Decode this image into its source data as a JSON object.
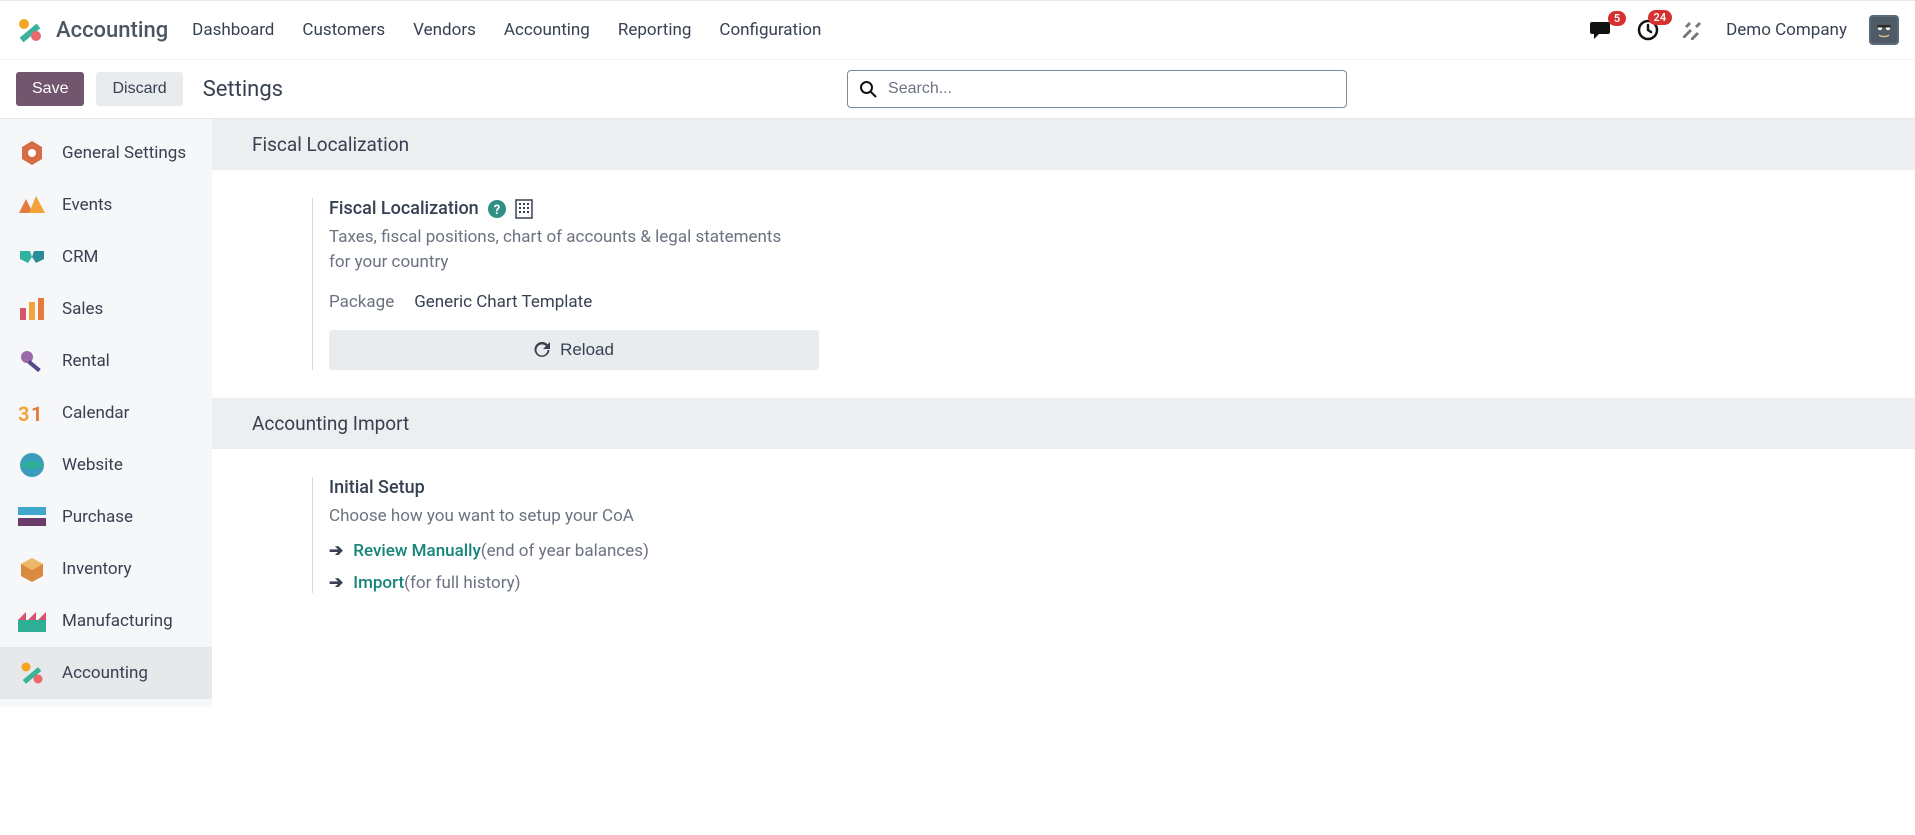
{
  "header": {
    "app_title": "Accounting",
    "nav": [
      "Dashboard",
      "Customers",
      "Vendors",
      "Accounting",
      "Reporting",
      "Configuration"
    ],
    "messages_badge": "5",
    "activities_badge": "24",
    "company": "Demo Company"
  },
  "controls": {
    "save": "Save",
    "discard": "Discard",
    "page_title": "Settings",
    "search_placeholder": "Search..."
  },
  "sidebar": {
    "items": [
      {
        "label": "General Settings"
      },
      {
        "label": "Events"
      },
      {
        "label": "CRM"
      },
      {
        "label": "Sales"
      },
      {
        "label": "Rental"
      },
      {
        "label": "Calendar"
      },
      {
        "label": "Website"
      },
      {
        "label": "Purchase"
      },
      {
        "label": "Inventory"
      },
      {
        "label": "Manufacturing"
      },
      {
        "label": "Accounting"
      }
    ],
    "active_index": 10
  },
  "sections": {
    "fiscal": {
      "header": "Fiscal Localization",
      "title": "Fiscal Localization",
      "desc": "Taxes, fiscal positions, chart of accounts & legal statements for your country",
      "package_label": "Package",
      "package_value": "Generic Chart Template",
      "reload": "Reload"
    },
    "import": {
      "header": "Accounting Import",
      "title": "Initial Setup",
      "desc": "Choose how you want to setup your CoA",
      "review_link": "Review Manually",
      "review_paren": "(end of year balances)",
      "import_link": "Import",
      "import_paren": "(for full history)"
    }
  }
}
